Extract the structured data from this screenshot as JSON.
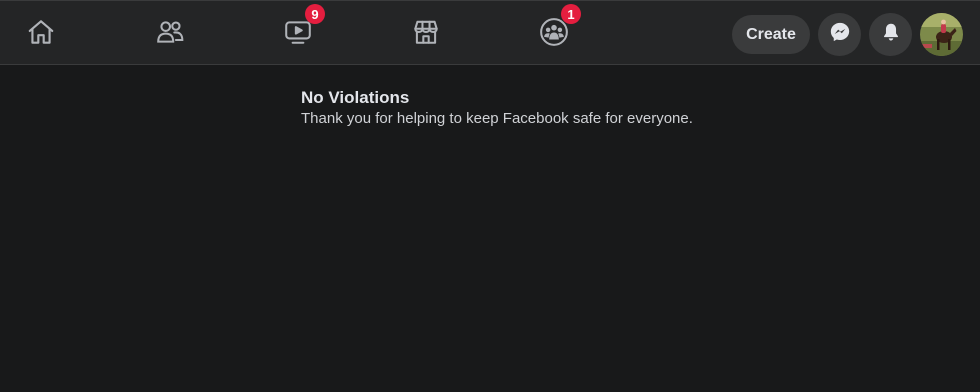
{
  "nav": {
    "tabs": [
      {
        "name": "Home",
        "icon": "home-icon",
        "badge": null
      },
      {
        "name": "Friends",
        "icon": "friends-icon",
        "badge": null
      },
      {
        "name": "Watch",
        "icon": "watch-icon",
        "badge": "9"
      },
      {
        "name": "Marketplace",
        "icon": "marketplace-icon",
        "badge": null
      },
      {
        "name": "Groups",
        "icon": "groups-icon",
        "badge": "1"
      }
    ],
    "create_label": "Create",
    "messenger_icon": "messenger-icon",
    "notifications_icon": "bell-icon",
    "avatar_icon": "avatar"
  },
  "main": {
    "title": "No Violations",
    "message": "Thank you for helping to keep Facebook safe for everyone."
  },
  "colors": {
    "background": "#18191a",
    "topbar": "#242526",
    "button": "#3a3b3c",
    "badge": "#e41e3f",
    "text": "#e4e6eb"
  }
}
